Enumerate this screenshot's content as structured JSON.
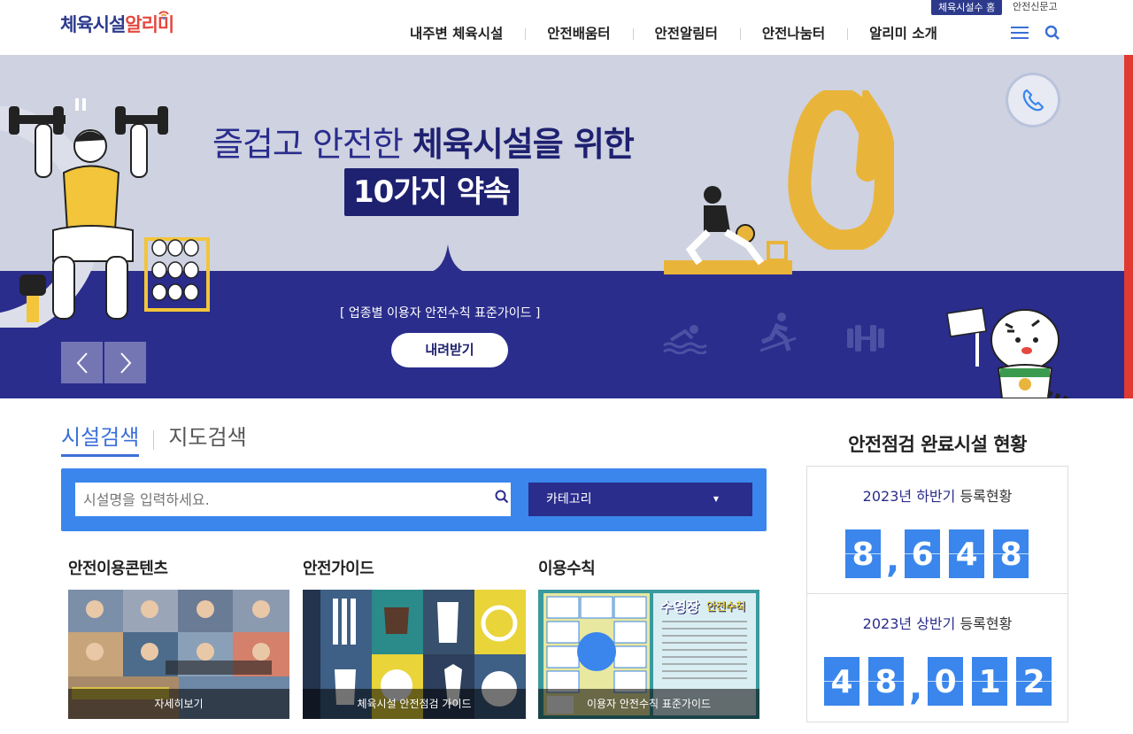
{
  "header": {
    "logo_part1": "체육시설",
    "logo_part2": "알리미",
    "top_button": "체육시설수 홈",
    "top_link": "안전신문고",
    "nav": [
      "내주변 체육시설",
      "안전배움터",
      "안전알림터",
      "안전나눔터",
      "알리미 소개"
    ]
  },
  "banner": {
    "title_light": "즐겁고 안전한 ",
    "title_bold": "체육시설을 위한",
    "subtitle": "10가지 약속",
    "guide": "[ 업종별 이용자 안전수칙 표준가이드 ]",
    "download_button": "내려받기",
    "colors": {
      "upper": "#cfd2e0",
      "lower": "#2a2d8c",
      "accent": "#e9b43a"
    }
  },
  "search": {
    "tabs": [
      "시설검색",
      "지도검색"
    ],
    "placeholder": "시설명을 입력하세요.",
    "category": "카테고리"
  },
  "cards": [
    {
      "title": "안전이용콘텐츠",
      "caption": "자세히보기"
    },
    {
      "title": "안전가이드",
      "caption": "체육시설 안전점검 가이드"
    },
    {
      "title": "이용수칙",
      "caption": "이용자 안전수칙 표준가이드",
      "poster_title": "수영장",
      "poster_sub": "안전수칙"
    }
  ],
  "stats": {
    "title": "안전점검 완료시설 현황",
    "items": [
      {
        "year": "2023년",
        "period": "하반기",
        "suffix": " 등록현황",
        "value": "8,648"
      },
      {
        "year": "2023년",
        "period": "상반기",
        "suffix": " 등록현황",
        "value": "48,012"
      }
    ]
  }
}
